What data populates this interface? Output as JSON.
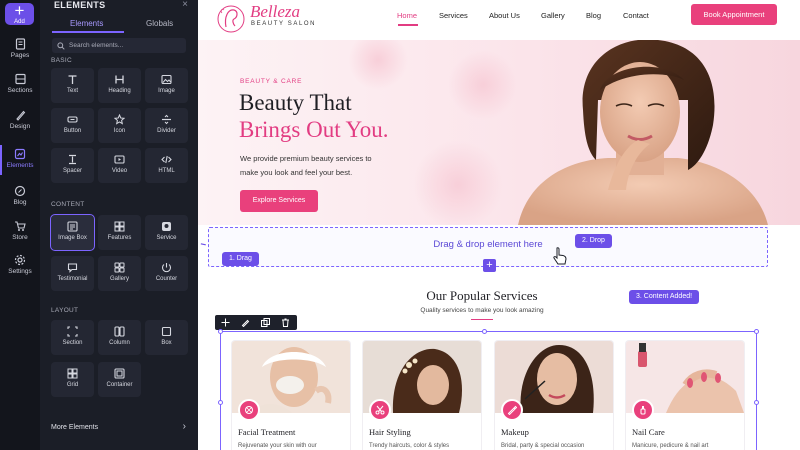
{
  "rail": {
    "add_label": "Add",
    "items": [
      {
        "label": "Pages",
        "icon": "pages-icon"
      },
      {
        "label": "Sections",
        "icon": "sections-icon"
      },
      {
        "label": "Design",
        "icon": "brush-icon"
      },
      {
        "label": "Elements",
        "icon": "elements-icon",
        "active": true
      },
      {
        "label": "Blog",
        "icon": "blog-icon"
      },
      {
        "label": "Store",
        "icon": "cart-icon"
      },
      {
        "label": "Settings",
        "icon": "gear-icon"
      }
    ]
  },
  "panel": {
    "title": "ELEMENTS",
    "tabs": [
      "Elements",
      "Globals"
    ],
    "search_placeholder": "Search elements...",
    "sections": {
      "basic": "BASIC",
      "content": "CONTENT",
      "layout": "LAYOUT"
    },
    "basic_items": [
      "Text",
      "Heading",
      "Image",
      "Button",
      "Icon",
      "Divider",
      "Spacer",
      "Video",
      "HTML"
    ],
    "content_items": [
      "Image Box",
      "Features",
      "Service",
      "Testimonial",
      "Gallery",
      "Counter"
    ],
    "layout_items": [
      "Section",
      "Column",
      "Box",
      "Grid",
      "Container"
    ],
    "more": "More Elements"
  },
  "site": {
    "logo": {
      "name": "Belleza",
      "tagline": "BEAUTY SALON"
    },
    "nav": [
      "Home",
      "Services",
      "About Us",
      "Gallery",
      "Blog",
      "Contact"
    ],
    "nav_active": "Home",
    "cta": "Book Appointment",
    "hero": {
      "eyebrow": "BEAUTY & CARE",
      "title_line1": "Beauty That",
      "title_line2": "Brings Out You.",
      "text": "We provide premium beauty services to make you look and feel your best.",
      "button": "Explore Services"
    },
    "dropzone": {
      "text": "Drag & drop element here",
      "step1": "1. Drag",
      "step2": "2. Drop",
      "step3": "3. Content Added!"
    },
    "services": {
      "title": "Our Popular Services",
      "subtitle": "Quality services to make you look amazing",
      "cards": [
        {
          "title": "Facial Treatment",
          "desc": "Rejuvenate your skin with our",
          "icon": "face-icon"
        },
        {
          "title": "Hair Styling",
          "desc": "Trendy haircuts, color & styles",
          "icon": "scissors-icon"
        },
        {
          "title": "Makeup",
          "desc": "Bridal, party & special occasion",
          "icon": "brush-icon"
        },
        {
          "title": "Nail Care",
          "desc": "Manicure, pedicure & nail art",
          "icon": "nail-polish-icon"
        }
      ]
    }
  },
  "colors": {
    "accent": "#e9407c",
    "editor_purple": "#6c4fe8",
    "panel_bg": "#1b1e27"
  }
}
